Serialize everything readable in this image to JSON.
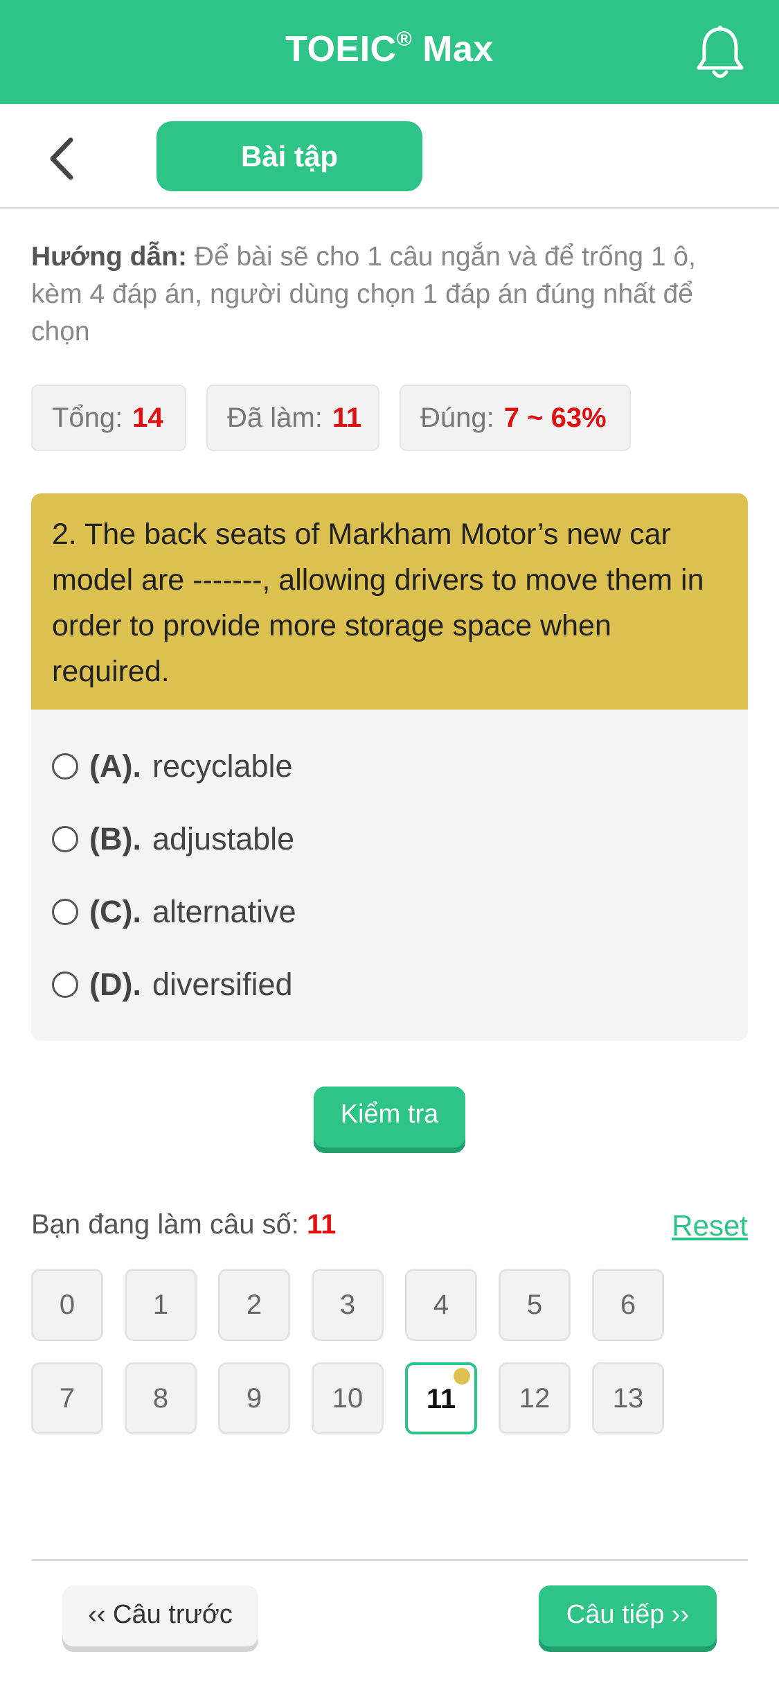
{
  "header": {
    "title": "TOEIC",
    "title_reg": "®",
    "title_suffix": "Max",
    "bell_icon": "bell-icon"
  },
  "subheader": {
    "back_icon": "chevron-left-icon",
    "tab_label": "Bài tập"
  },
  "guide": {
    "label": "Hướng dẫn:",
    "text": "Để bài sẽ cho 1 câu ngắn và để trống 1 ô, kèm 4 đáp án, người dùng chọn 1 đáp án đúng nhất để chọn"
  },
  "stats": {
    "total_label": "Tổng:",
    "total_value": "14",
    "done_label": "Đã làm:",
    "done_value": "11",
    "correct_label": "Đúng:",
    "correct_value": "7 ~ 63%"
  },
  "question": {
    "text": "2. The back seats of Markham Motor’s new car model are -------, allowing drivers to move them in order to provide more storage space when required.",
    "options": [
      {
        "letter": "(A).",
        "text": "recyclable"
      },
      {
        "letter": "(B).",
        "text": "adjustable"
      },
      {
        "letter": "(C).",
        "text": "alternative"
      },
      {
        "letter": "(D).",
        "text": "diversified"
      }
    ]
  },
  "check_button": "Kiểm tra",
  "progress": {
    "label": "Bạn đang làm câu số:",
    "current": "11",
    "reset": "Reset"
  },
  "numbers": [
    "0",
    "1",
    "2",
    "3",
    "4",
    "5",
    "6",
    "7",
    "8",
    "9",
    "10",
    "11",
    "12",
    "13"
  ],
  "active_number": "11",
  "nav": {
    "prev": "‹‹ Câu trước",
    "next": "Câu tiếp ››"
  },
  "colors": {
    "primary": "#2ec488",
    "question_bg": "#dcc050",
    "accent_red": "#e01010"
  }
}
